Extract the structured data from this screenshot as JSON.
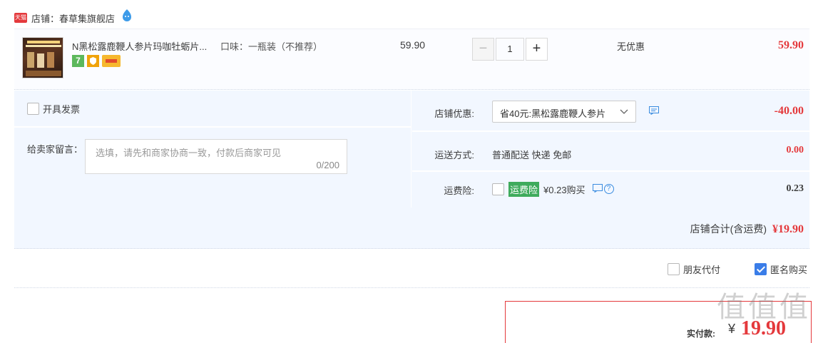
{
  "shop": {
    "badge": "天猫",
    "label": "店铺：春草集旗舰店",
    "icon": "wangwang-icon"
  },
  "item": {
    "title": "N黑松露鹿鞭人参片玛咖牡蛎片...",
    "sku": "口味：一瓶装（不推荐）",
    "unit_price": "59.90",
    "quantity": "1",
    "minus": "−",
    "plus": "+",
    "discount": "无优惠",
    "total": "59.90",
    "tag_7": "7"
  },
  "invoice": {
    "label": "开具发票"
  },
  "memo": {
    "label": "给卖家留言：",
    "placeholder": "选填，请先和商家协商一致，付款后商家可见",
    "count": "0/200"
  },
  "shop_discount": {
    "label": "店铺优惠:",
    "selected": "省40元:黑松露鹿鞭人参片",
    "amount": "-40.00"
  },
  "shipping": {
    "label": "运送方式:",
    "value": "普通配送 快递 免邮",
    "amount": "0.00"
  },
  "insurance": {
    "label": "运费险:",
    "badge": "运费险",
    "text": "¥0.23购买",
    "help": "?",
    "amount": "0.23"
  },
  "shop_total": {
    "label": "店铺合计(含运费)",
    "amount": "¥19.90"
  },
  "options": {
    "friend_pay": "朋友代付",
    "anonymous": "匿名购买",
    "anonymous_checked": true
  },
  "payment": {
    "label": "实付款:",
    "yen": "¥",
    "amount": "19.90"
  },
  "watermark": "值值值",
  "colors": {
    "accent": "#e4393c",
    "checkbox": "#3a7de8",
    "row_bg": "#f2f7ff",
    "insurance_badge": "#3fab5c"
  }
}
